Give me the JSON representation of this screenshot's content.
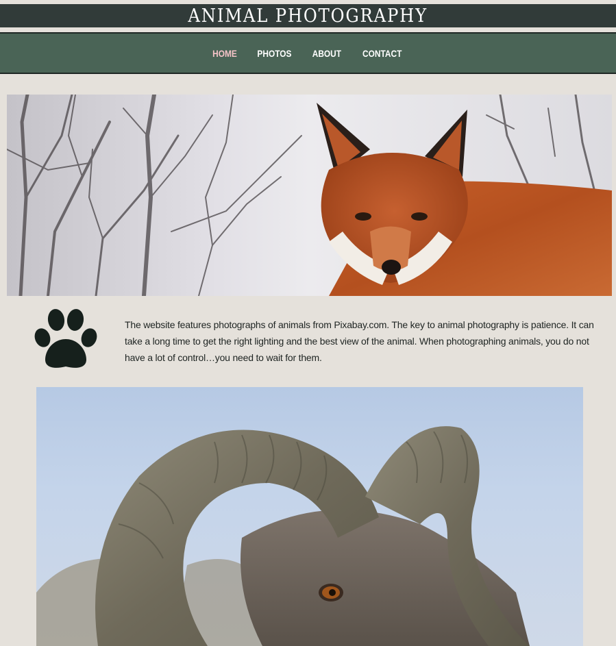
{
  "header": {
    "title": "ANIMAL PHOTOGRAPHY",
    "colors": {
      "title_bar": "#313b39",
      "nav_bar": "#4a6456",
      "background": "#e5e1db",
      "active_link": "#f6c4c8"
    }
  },
  "nav": {
    "items": [
      {
        "label": "HOME",
        "active": true
      },
      {
        "label": "PHOTOS",
        "active": false
      },
      {
        "label": "ABOUT",
        "active": false
      },
      {
        "label": "CONTACT",
        "active": false
      }
    ]
  },
  "hero": {
    "subject": "fox"
  },
  "intro": {
    "icon": "paw-print-icon",
    "text": "The website features photographs of animals from Pixabay.com. The key to animal photography is patience. It can take a long time to get the right lighting and the best view of the animal. When photographing animals, you do not have a lot of control…you need to wait for them."
  },
  "gallery": {
    "subject": "bighorn ram"
  }
}
